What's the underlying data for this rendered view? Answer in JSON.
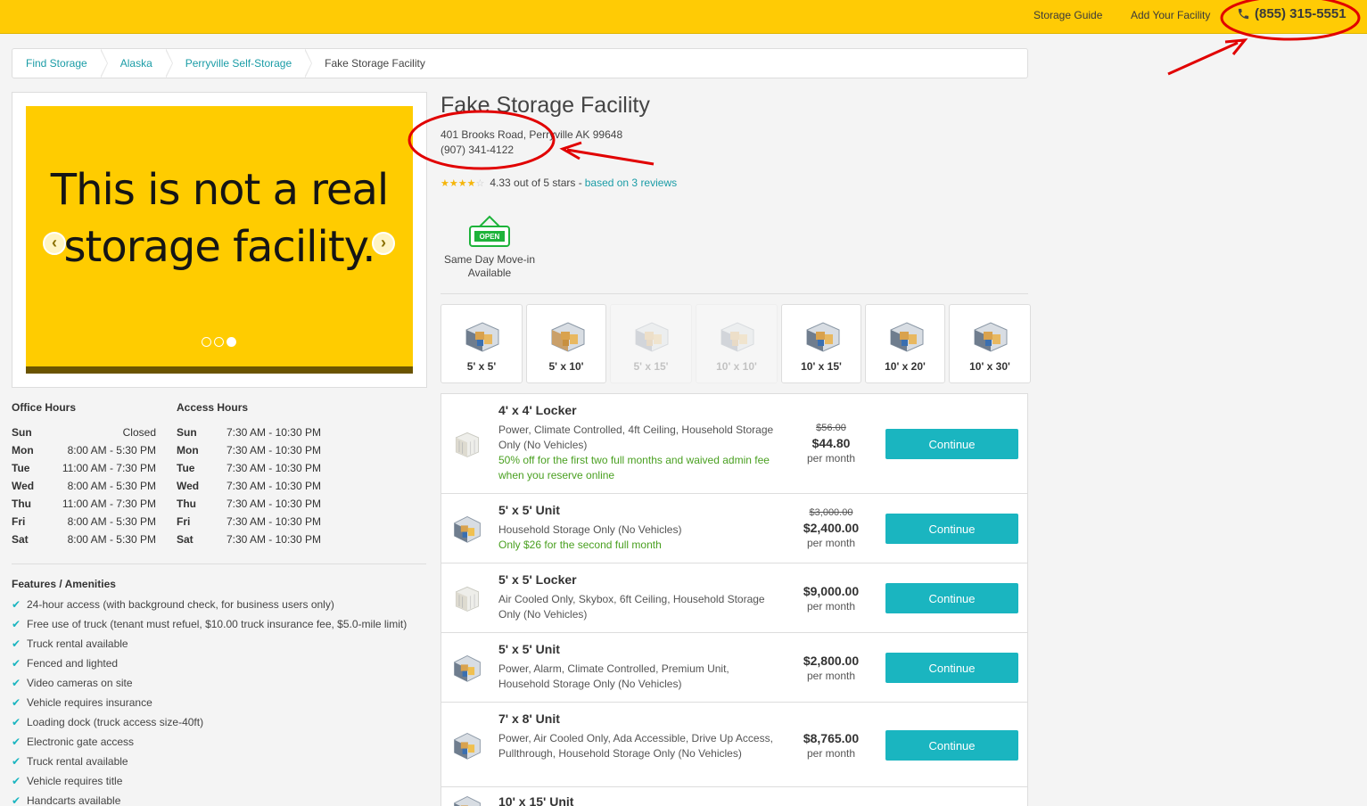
{
  "header": {
    "storage_guide": "Storage Guide",
    "add_facility": "Add Your Facility",
    "phone": "(855) 315-5551"
  },
  "breadcrumb": {
    "items": [
      "Find Storage",
      "Alaska",
      "Perryville Self-Storage",
      "Fake Storage Facility"
    ]
  },
  "gallery": {
    "slide_text_line1": "This is not a real",
    "slide_text_line2": "storage facility.",
    "prev_glyph": "‹",
    "next_glyph": "›",
    "slide_count": 3,
    "active_slide": 3
  },
  "hours": {
    "office_heading": "Office Hours",
    "access_heading": "Access Hours",
    "office": [
      {
        "day": "Sun",
        "time": "Closed"
      },
      {
        "day": "Mon",
        "time": "8:00 AM - 5:30 PM"
      },
      {
        "day": "Tue",
        "time": "11:00 AM - 7:30 PM"
      },
      {
        "day": "Wed",
        "time": "8:00 AM - 5:30 PM"
      },
      {
        "day": "Thu",
        "time": "11:00 AM - 7:30 PM"
      },
      {
        "day": "Fri",
        "time": "8:00 AM - 5:30 PM"
      },
      {
        "day": "Sat",
        "time": "8:00 AM - 5:30 PM"
      }
    ],
    "access": [
      {
        "day": "Sun",
        "time": "7:30 AM - 10:30 PM"
      },
      {
        "day": "Mon",
        "time": "7:30 AM - 10:30 PM"
      },
      {
        "day": "Tue",
        "time": "7:30 AM - 10:30 PM"
      },
      {
        "day": "Wed",
        "time": "7:30 AM - 10:30 PM"
      },
      {
        "day": "Thu",
        "time": "7:30 AM - 10:30 PM"
      },
      {
        "day": "Fri",
        "time": "7:30 AM - 10:30 PM"
      },
      {
        "day": "Sat",
        "time": "7:30 AM - 10:30 PM"
      }
    ]
  },
  "features": {
    "heading": "Features / Amenities",
    "items": [
      "24-hour access (with background check, for business users only)",
      "Free use of truck (tenant must refuel, $10.00 truck insurance fee, $5.0-mile limit)",
      "Truck rental available",
      "Fenced and lighted",
      "Video cameras on site",
      "Vehicle requires insurance",
      "Loading dock (truck access size-40ft)",
      "Electronic gate access",
      "Truck rental available",
      "Vehicle requires title",
      "Handcarts available"
    ]
  },
  "facility": {
    "name": "Fake Storage Facility",
    "address": "401 Brooks Road, Perryville AK 99648",
    "phone": "(907) 341-4122",
    "rating_value": 4.33,
    "rating_text": "4.33 out of 5 stars -",
    "reviews_link": "based on 3 reviews",
    "open_sign": "OPEN",
    "move_in_line1": "Same Day Move-in",
    "move_in_line2": "Available"
  },
  "size_filters": [
    {
      "label": "5' x 5'",
      "enabled": true
    },
    {
      "label": "5' x 10'",
      "enabled": true
    },
    {
      "label": "5' x 15'",
      "enabled": false
    },
    {
      "label": "10' x 10'",
      "enabled": false
    },
    {
      "label": "10' x 15'",
      "enabled": true
    },
    {
      "label": "10' x 20'",
      "enabled": true
    },
    {
      "label": "10' x 30'",
      "enabled": true
    }
  ],
  "units": [
    {
      "title": "4' x 4' Locker",
      "desc": "Power, Climate Controlled, 4ft Ceiling, Household Storage Only (No Vehicles)",
      "promo": "50% off for the first two full months and waived admin fee when you reserve online",
      "old_price": "$56.00",
      "price": "$44.80",
      "per": "per month",
      "button": "Continue",
      "icon": "locker-icon"
    },
    {
      "title": "5' x 5' Unit",
      "desc": "Household Storage Only (No Vehicles)",
      "promo": "Only $26 for the second full month",
      "old_price": "$3,000.00",
      "price": "$2,400.00",
      "per": "per month",
      "button": "Continue",
      "icon": "unit-icon"
    },
    {
      "title": "5' x 5' Locker",
      "desc": "Air Cooled Only, Skybox, 6ft Ceiling, Household Storage Only (No Vehicles)",
      "promo": "",
      "old_price": "",
      "price": "$9,000.00",
      "per": "per month",
      "button": "Continue",
      "icon": "locker-icon"
    },
    {
      "title": "5' x 5' Unit",
      "desc": "Power, Alarm, Climate Controlled, Premium Unit, Household Storage Only (No Vehicles)",
      "promo": "",
      "old_price": "",
      "price": "$2,800.00",
      "per": "per month",
      "button": "Continue",
      "icon": "unit-icon"
    },
    {
      "title": "7' x 8' Unit",
      "desc": "Power, Air Cooled Only, Ada Accessible, Drive Up Access, Pullthrough, Household Storage Only (No Vehicles)",
      "promo": "",
      "old_price": "",
      "price": "$8,765.00",
      "per": "per month",
      "button": "Continue",
      "icon": "unit-icon"
    },
    {
      "title": "10' x 15' Unit",
      "desc": "",
      "promo": "",
      "old_price": "",
      "price": "",
      "per": "",
      "button": "",
      "icon": "unit-icon"
    }
  ],
  "colors": {
    "brand_yellow": "#ffcb05",
    "accent_teal": "#1ab5c0",
    "promo_green": "#4aa021",
    "annotation_red": "#e10000"
  }
}
